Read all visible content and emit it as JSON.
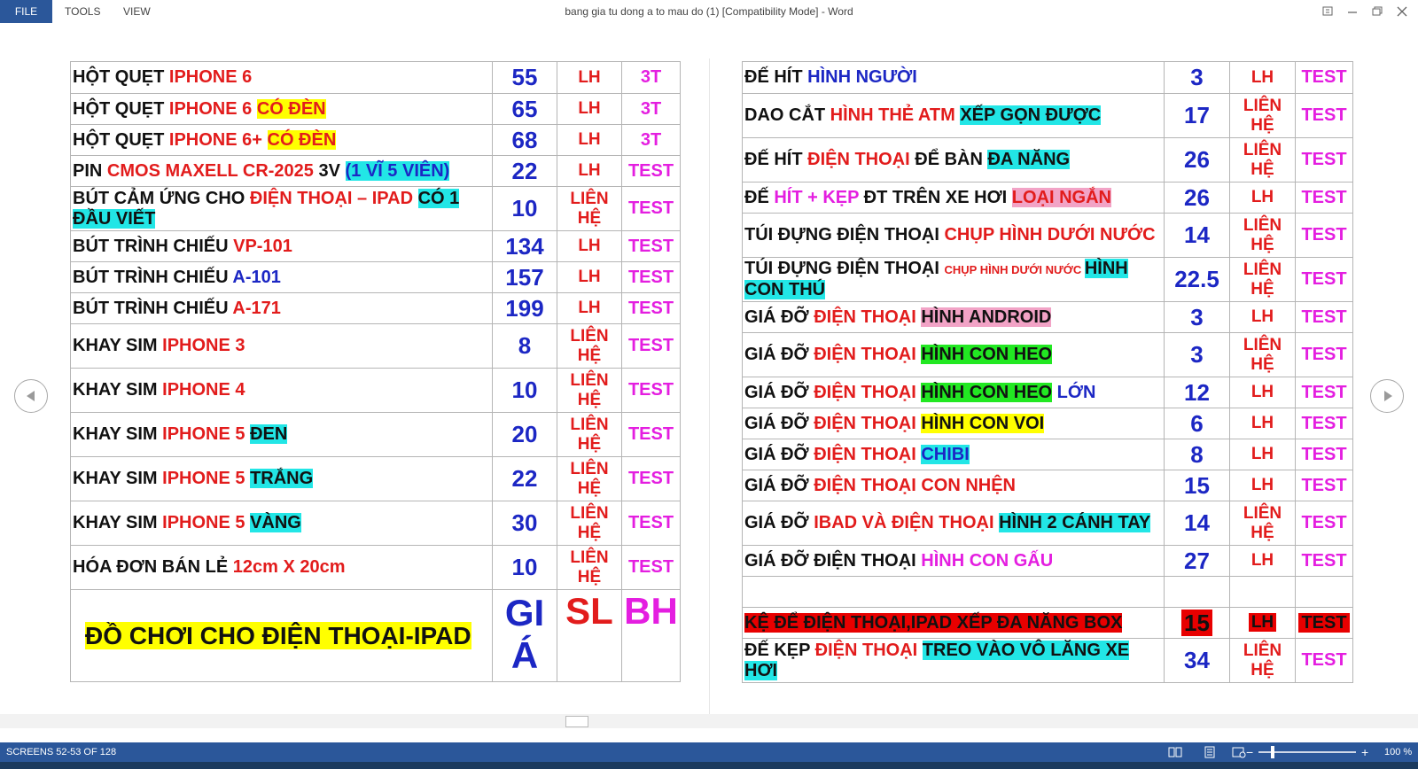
{
  "menu": {
    "file": "FILE",
    "tools": "TOOLS",
    "view": "VIEW"
  },
  "window_title": "bang gia tu dong a to mau do (1) [Compatibility Mode] - Word",
  "left_rows": [
    {
      "segs": [
        {
          "t": "HỘT QUẸT ",
          "c": "k"
        },
        {
          "t": "IPHONE 6",
          "c": "r"
        }
      ],
      "price": "55",
      "qty": "LH",
      "wty": "3T",
      "h": 36
    },
    {
      "segs": [
        {
          "t": "HỘT QUẸT ",
          "c": "k"
        },
        {
          "t": "IPHONE 6 ",
          "c": "r"
        },
        {
          "t": "CÓ ĐÈN",
          "c": "r hl-y"
        }
      ],
      "price": "65",
      "qty": "LH",
      "wty": "3T",
      "h": 35
    },
    {
      "segs": [
        {
          "t": "HỘT QUẸT ",
          "c": "k"
        },
        {
          "t": "IPHONE 6+ ",
          "c": "r"
        },
        {
          "t": "CÓ ĐÈN",
          "c": "r hl-y"
        }
      ],
      "price": "68",
      "qty": "LH",
      "wty": "3T",
      "h": 35
    },
    {
      "segs": [
        {
          "t": "PIN ",
          "c": "k"
        },
        {
          "t": "CMOS MAXELL CR-2025 ",
          "c": "r"
        },
        {
          "t": "3V ",
          "c": "k"
        },
        {
          "t": "(1 VĨ 5 VIÊN)",
          "c": "b hl-c"
        }
      ],
      "price": "22",
      "qty": "LH",
      "wty": "TEST",
      "h": 35
    },
    {
      "segs": [
        {
          "t": "BÚT CẢM ỨNG CHO ",
          "c": "k"
        },
        {
          "t": "ĐIỆN THOẠI – IPAD ",
          "c": "r"
        },
        {
          "t": "CÓ 1 ĐẦU VIẾT",
          "c": "k hl-c"
        }
      ],
      "price": "10",
      "qty": "LIÊN HỆ",
      "wty": "TEST",
      "h": 50
    },
    {
      "segs": [
        {
          "t": "BÚT TRÌNH CHIẾU ",
          "c": "k"
        },
        {
          "t": "VP-101",
          "c": "r"
        }
      ],
      "price": "134",
      "qty": "LH",
      "wty": "TEST",
      "h": 35
    },
    {
      "segs": [
        {
          "t": "BÚT TRÌNH CHIẾU ",
          "c": "k"
        },
        {
          "t": "A-101",
          "c": "b"
        }
      ],
      "price": "157",
      "qty": "LH",
      "wty": "TEST",
      "h": 35
    },
    {
      "segs": [
        {
          "t": "BÚT TRÌNH CHIẾU ",
          "c": "k"
        },
        {
          "t": "A-171",
          "c": "r"
        }
      ],
      "price": "199",
      "qty": "LH",
      "wty": "TEST",
      "h": 35
    },
    {
      "segs": [
        {
          "t": "KHAY SIM ",
          "c": "k"
        },
        {
          "t": "IPHONE 3",
          "c": "r"
        }
      ],
      "price": "8",
      "qty": "LIÊN HỆ",
      "wty": "TEST",
      "h": 50
    },
    {
      "segs": [
        {
          "t": "KHAY SIM ",
          "c": "k"
        },
        {
          "t": "IPHONE 4",
          "c": "r"
        }
      ],
      "price": "10",
      "qty": "LIÊN HỆ",
      "wty": "TEST",
      "h": 50
    },
    {
      "segs": [
        {
          "t": "KHAY SIM ",
          "c": "k"
        },
        {
          "t": "IPHONE 5 ",
          "c": "r"
        },
        {
          "t": "ĐEN",
          "c": "k hl-c"
        }
      ],
      "price": "20",
      "qty": "LIÊN HỆ",
      "wty": "TEST",
      "h": 50
    },
    {
      "segs": [
        {
          "t": "KHAY SIM ",
          "c": "k"
        },
        {
          "t": "IPHONE 5 ",
          "c": "r"
        },
        {
          "t": "TRẮNG",
          "c": "k hl-c"
        }
      ],
      "price": "22",
      "qty": "LIÊN HỆ",
      "wty": "TEST",
      "h": 50
    },
    {
      "segs": [
        {
          "t": "KHAY SIM ",
          "c": "k"
        },
        {
          "t": "IPHONE 5 ",
          "c": "r"
        },
        {
          "t": "VÀNG",
          "c": "k hl-c"
        }
      ],
      "price": "30",
      "qty": "LIÊN HỆ",
      "wty": "TEST",
      "h": 50
    },
    {
      "segs": [
        {
          "t": "HÓA ĐƠN BÁN LẺ ",
          "c": "k"
        },
        {
          "t": "12cm X 20cm",
          "c": "r"
        }
      ],
      "price": "10",
      "qty": "LIÊN HỆ",
      "wty": "TEST",
      "h": 50
    }
  ],
  "left_header": {
    "label": "ĐỒ CHƠI CHO ĐIỆN THOẠI-IPAD",
    "price": "GI Á",
    "qty": "SL",
    "wty": "BH"
  },
  "right_rows": [
    {
      "segs": [
        {
          "t": "ĐẾ HÍT ",
          "c": "k"
        },
        {
          "t": "HÌNH NGƯỜI",
          "c": "b"
        }
      ],
      "price": "3",
      "qty": "LH",
      "wty": "TEST",
      "h": 36
    },
    {
      "segs": [
        {
          "t": "DAO CẮT ",
          "c": "k"
        },
        {
          "t": "HÌNH THẺ ATM ",
          "c": "r"
        },
        {
          "t": "XẾP GỌN ĐƯỢC",
          "c": "k hl-c"
        }
      ],
      "price": "17",
      "qty": "LIÊN HỆ",
      "wty": "TEST",
      "h": 50
    },
    {
      "segs": [
        {
          "t": "ĐẾ HÍT ",
          "c": "k"
        },
        {
          "t": "ĐIỆN THOẠI ",
          "c": "r"
        },
        {
          "t": "ĐỂ BÀN ",
          "c": "k"
        },
        {
          "t": "ĐA NĂNG",
          "c": "k hl-c"
        }
      ],
      "price": "26",
      "qty": "LIÊN HỆ",
      "wty": "TEST",
      "h": 50
    },
    {
      "segs": [
        {
          "t": "ĐẾ ",
          "c": "k"
        },
        {
          "t": "HÍT + KẸP ",
          "c": "m"
        },
        {
          "t": "ĐT TRÊN XE HƠI ",
          "c": "k"
        },
        {
          "t": "LOẠI NGẮN",
          "c": "r hl-p"
        }
      ],
      "price": "26",
      "qty": "LH",
      "wty": "TEST",
      "h": 35
    },
    {
      "segs": [
        {
          "t": "TÚI ĐỰNG ĐIỆN THOẠI ",
          "c": "k"
        },
        {
          "t": "CHỤP HÌNH DƯỚI NƯỚC",
          "c": "r"
        }
      ],
      "price": "14",
      "qty": "LIÊN HỆ",
      "wty": "TEST",
      "h": 50
    },
    {
      "segs": [
        {
          "t": "TÚI ĐỰNG ĐIỆN THOẠI ",
          "c": "k"
        },
        {
          "t": "CHỤP HÌNH DƯỚI NƯỚC ",
          "c": "r small"
        },
        {
          "t": "HÌNH CON THÚ",
          "c": "k hl-c"
        }
      ],
      "price": "22.5",
      "qty": "LIÊN HỆ",
      "wty": "TEST",
      "h": 50
    },
    {
      "segs": [
        {
          "t": "GIÁ ĐỠ ",
          "c": "k"
        },
        {
          "t": "ĐIỆN THOẠI ",
          "c": "r"
        },
        {
          "t": "HÌNH ANDROID",
          "c": "k hl-p"
        }
      ],
      "price": "3",
      "qty": "LH",
      "wty": "TEST",
      "h": 35
    },
    {
      "segs": [
        {
          "t": "GIÁ ĐỠ ",
          "c": "k"
        },
        {
          "t": "ĐIỆN THOẠI ",
          "c": "r"
        },
        {
          "t": "HÌNH CON HEO",
          "c": "k hl-g"
        }
      ],
      "price": "3",
      "qty": "LIÊN HỆ",
      "wty": "TEST",
      "h": 50
    },
    {
      "segs": [
        {
          "t": "GIÁ ĐỠ ",
          "c": "k"
        },
        {
          "t": "ĐIỆN THOẠI ",
          "c": "r"
        },
        {
          "t": "HÌNH CON HEO",
          "c": "k hl-g"
        },
        {
          "t": " LỚN",
          "c": "b"
        }
      ],
      "price": "12",
      "qty": "LH",
      "wty": "TEST",
      "h": 35
    },
    {
      "segs": [
        {
          "t": "GIÁ ĐỠ ",
          "c": "k"
        },
        {
          "t": "ĐIỆN THOẠI ",
          "c": "r"
        },
        {
          "t": "HÌNH CON VOI",
          "c": "k hl-y"
        }
      ],
      "price": "6",
      "qty": "LH",
      "wty": "TEST",
      "h": 35
    },
    {
      "segs": [
        {
          "t": "GIÁ ĐỠ ",
          "c": "k"
        },
        {
          "t": "ĐIỆN THOẠI ",
          "c": "r"
        },
        {
          "t": "CHIBI",
          "c": "b hl-c"
        }
      ],
      "price": "8",
      "qty": "LH",
      "wty": "TEST",
      "h": 35
    },
    {
      "segs": [
        {
          "t": "GIÁ ĐỠ ",
          "c": "k"
        },
        {
          "t": "ĐIỆN THOẠI ",
          "c": "r"
        },
        {
          "t": "CON NHỆN",
          "c": "r"
        }
      ],
      "price": "15",
      "qty": "LH",
      "wty": "TEST",
      "h": 35
    },
    {
      "segs": [
        {
          "t": "GIÁ ĐỠ ",
          "c": "k"
        },
        {
          "t": "IBAD VÀ ĐIỆN THOẠI ",
          "c": "r"
        },
        {
          "t": "HÌNH 2 CÁNH TAY",
          "c": "k hl-c"
        }
      ],
      "price": "14",
      "qty": "LIÊN HỆ",
      "wty": "TEST",
      "h": 50
    },
    {
      "segs": [
        {
          "t": "GIÁ ĐỠ ĐIỆN THOẠI ",
          "c": "k"
        },
        {
          "t": "HÌNH CON GẤU",
          "c": "m"
        }
      ],
      "price": "27",
      "qty": "LH",
      "wty": "TEST",
      "h": 35
    },
    {
      "segs": [],
      "price": "",
      "qty": "",
      "wty": "",
      "h": 35
    },
    {
      "segs": [
        {
          "t": "KỆ ĐỂ ĐIỆN THOẠI,IPAD XẾP ĐA NĂNG BOX",
          "c": "hl-r"
        }
      ],
      "price": "15",
      "qty": "LH",
      "wty": "TEST",
      "h": 35,
      "red": true
    },
    {
      "segs": [
        {
          "t": "ĐẾ KẸP ",
          "c": "k"
        },
        {
          "t": "ĐIỆN THOẠI ",
          "c": "r"
        },
        {
          "t": "TREO VÀO VÔ LĂNG XE HƠI",
          "c": "k hl-c"
        }
      ],
      "price": "34",
      "qty": "LIÊN HỆ",
      "wty": "TEST",
      "h": 50
    }
  ],
  "status": {
    "screens": "SCREENS 52-53 OF 128",
    "zoom": "100 %",
    "zoom_level": 1.0
  },
  "colors": {
    "accent": "#2b579a",
    "price_blue": "#1c27c4",
    "red": "#e21c1c",
    "magenta": "#e41ee0"
  }
}
